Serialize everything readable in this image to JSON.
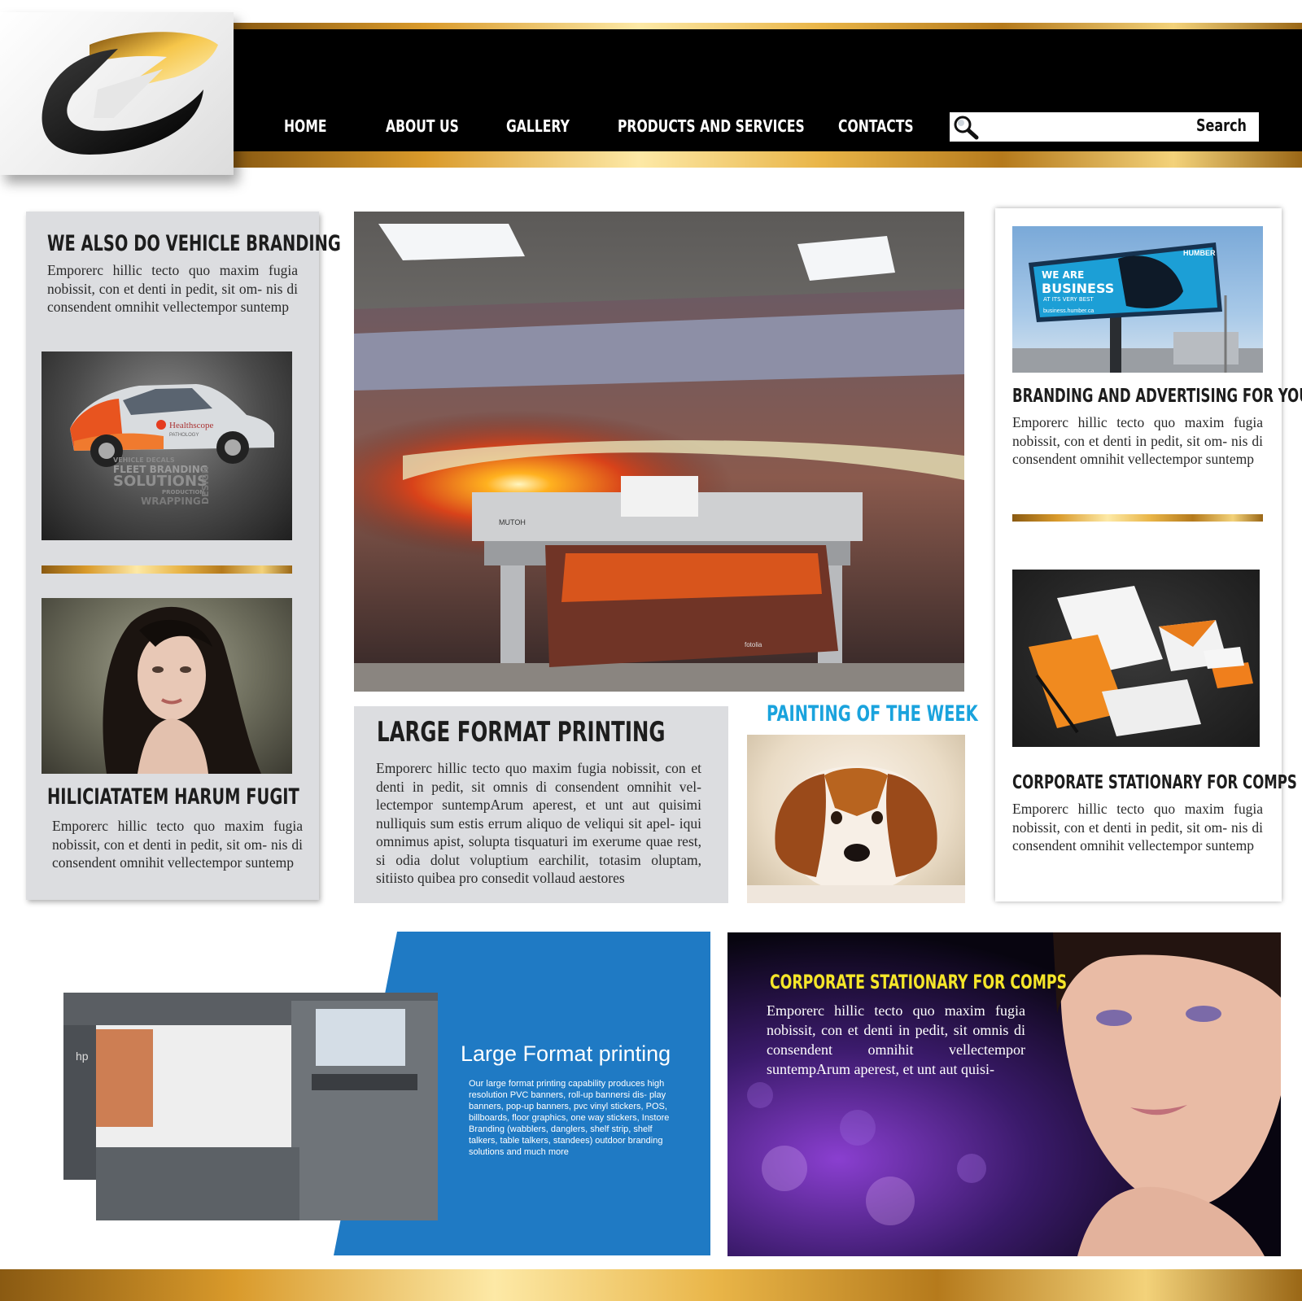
{
  "header": {
    "logo_alt": "logo-mark",
    "nav": [
      "HOME",
      "ABOUT US",
      "GALLERY",
      "PRODUCTS AND SERVICES",
      "CONTACTS"
    ],
    "search": {
      "placeholder": "",
      "button_label": "Search"
    }
  },
  "left_panel": {
    "heading1": "WE ALSO DO VEHICLE BRANDING",
    "text1": "Emporerc hillic tecto quo maxim fugia nobissit, con et denti in pedit, sit om- nis di consendent omnihit vellectempor suntemp",
    "car_badge": "Healthscope",
    "car_badge_sub": "PATHOLOGY",
    "car_words": [
      "VEHICLE DECALS",
      "FLEET BRANDING",
      "SOLUTIONS",
      "PRODUCTION",
      "WRAPPING",
      "DESIGN"
    ],
    "heading2": "HILICIATATEM HARUM FUGIT",
    "text2": "Emporerc hillic tecto quo maxim fugia nobissit, con et denti in pedit, sit om- nis di consendent omnihit vellectempor suntemp"
  },
  "center": {
    "printer_brand": "MUTOH",
    "print_brand": "fotolia",
    "lfp_heading": "LARGE FORMAT PRINTING",
    "lfp_text": "Emporerc hillic tecto quo maxim fugia nobissit, con et denti in pedit, sit omnis di consendent omnihit vel- lectempor suntempArum aperest, et unt aut quisimi nulliquis sum estis errum aliquo de veliqui sit apel- iqui omnimus apist, solupta tisquaturi im exerume quae rest, si odia dolut voluptium earchilit, totasim oluptam, sitiisto quibea pro consedit vollaud aestores",
    "painting_heading": "PAINTING OF THE WEEK"
  },
  "right_panel": {
    "billboard": {
      "brand": "HUMBER",
      "line1": "WE ARE",
      "line2": "BUSINESS",
      "line3": "AT ITS VERY BEST",
      "url": "business.humber.ca"
    },
    "heading1": "BRANDING AND ADVERTISING FOR YOU",
    "text1": "Emporerc hillic tecto quo maxim fugia nobissit, con et denti in pedit, sit om- nis di consendent omnihit vellectempor suntemp",
    "heading2": "CORPORATE STATIONARY FOR COMPS",
    "text2": "Emporerc hillic tecto quo maxim fugia nobissit, con et denti in pedit, sit om- nis di consendent omnihit vellectempor suntemp"
  },
  "bottom_left": {
    "title": "Large Format printing",
    "text": "Our large format printing capability produces high resolution PVC banners, roll-up bannersi dis- play banners, pop-up banners, pvc vinyl stickers, POS, billboards, floor graphics, one way stickers, Instore Branding (wabblers, danglers, shelf strip, shelf talkers, table talkers, standees) outdoor branding solutions and much more",
    "printer_logo": "hp"
  },
  "bottom_right": {
    "heading": "CORPORATE STATIONARY FOR COMPS",
    "text": "Emporerc hillic tecto quo maxim fugia nobissit, con et denti in pedit, sit omnis di consendent omnihit vellectempor suntempArum aperest, et unt aut quisi-"
  },
  "colors": {
    "gold_light": "#fde9a6",
    "gold_dark": "#8a5a12",
    "header_bg": "#000000",
    "panel_gray": "#dcdde0",
    "blue": "#1f7ac4",
    "painting_heading": "#1aa3dd",
    "promo_heading": "#f5e629"
  },
  "icons": {
    "search": "magnifier-icon"
  }
}
